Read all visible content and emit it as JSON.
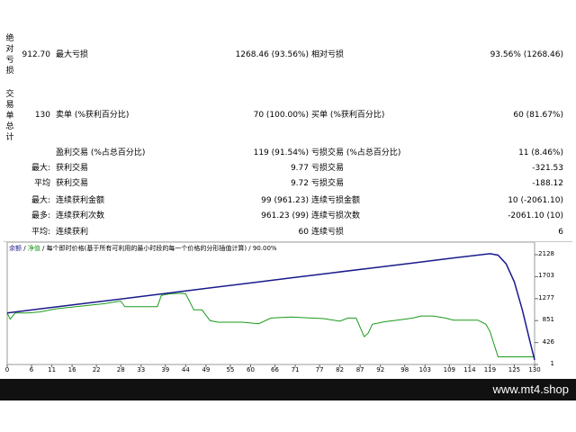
{
  "side_labels": {
    "drawdown": "绝对亏损",
    "trades": "交易单总计"
  },
  "rows": [
    {
      "c1": "912.70",
      "c2": "最大亏损",
      "c3": "1268.46 (93.56%)",
      "c4": "相对亏损",
      "c5": "93.56% (1268.46)"
    },
    {
      "c1": "130",
      "c2": "卖单 (%获利百分比)",
      "c3": "70 (100.00%)",
      "c4": "买单 (%获利百分比)",
      "c5": "60 (81.67%)"
    },
    {
      "c1": "",
      "c2": "盈利交易 (%占总百分比)",
      "c3": "119 (91.54%)",
      "c4": "亏损交易 (%占总百分比)",
      "c5": "11 (8.46%)"
    },
    {
      "c1": "最大:",
      "c2": "获利交易",
      "c3": "9.77",
      "c4": "亏损交易",
      "c5": "-321.53"
    },
    {
      "c1": "平均",
      "c2": "获利交易",
      "c3": "9.72",
      "c4": "亏损交易",
      "c5": "-188.12"
    },
    {
      "c1": "最大:",
      "c2": "连续获利金额",
      "c3": "99 (961.23)",
      "c4": "连续亏损金额",
      "c5": "10 (-2061.10)"
    },
    {
      "c1": "最多:",
      "c2": "连续获利次数",
      "c3": "961.23 (99)",
      "c4": "连续亏损次数",
      "c5": "-2061.10 (10)"
    },
    {
      "c1": "平均:",
      "c2": "连续获利",
      "c3": "60",
      "c4": "连续亏损",
      "c5": "6"
    }
  ],
  "legend": {
    "balance": "余额",
    "equity": "净值",
    "rest": " / 每个即时价格(基于所有可利用的最小时段的每一个价格的分形插值计算) / 90.00%"
  },
  "colors": {
    "balance": "#1a1a8c",
    "equity": "#1a9a1a"
  },
  "chart_data": {
    "type": "line",
    "x_ticks": [
      0,
      6,
      11,
      16,
      22,
      28,
      33,
      39,
      44,
      49,
      55,
      60,
      66,
      71,
      77,
      82,
      87,
      92,
      98,
      103,
      109,
      114,
      119,
      125,
      130
    ],
    "y_ticks": [
      2128,
      1703,
      1277,
      851,
      426,
      1
    ],
    "xlim": [
      0,
      130
    ],
    "ylim": [
      1,
      2128
    ],
    "series": [
      {
        "name": "余额",
        "x": [
          0,
          10,
          20,
          30,
          40,
          50,
          60,
          70,
          80,
          90,
          100,
          110,
          119,
          121,
          123,
          125,
          127,
          129,
          130
        ],
        "y": [
          1000,
          1097,
          1194,
          1290,
          1387,
          1484,
          1581,
          1678,
          1775,
          1871,
          1968,
          2065,
          2148,
          2120,
          1950,
          1600,
          1050,
          400,
          90
        ]
      },
      {
        "name": "净值",
        "x": [
          0,
          0.7,
          2,
          5,
          8,
          12,
          18,
          24,
          28,
          29,
          31,
          35,
          37,
          38,
          40,
          43,
          44,
          46,
          48,
          50,
          52,
          56,
          58,
          62,
          65,
          70,
          75,
          78,
          82,
          84,
          86,
          87,
          88,
          89,
          90,
          93,
          97,
          100,
          102,
          105,
          108,
          110,
          112,
          114,
          116,
          118,
          119,
          121,
          125,
          129,
          130
        ],
        "y": [
          1000,
          880,
          1000,
          1000,
          1020,
          1080,
          1130,
          1180,
          1230,
          1120,
          1120,
          1120,
          1120,
          1340,
          1370,
          1380,
          1370,
          1060,
          1060,
          850,
          820,
          820,
          820,
          790,
          900,
          920,
          900,
          890,
          840,
          900,
          900,
          720,
          540,
          610,
          780,
          830,
          870,
          900,
          940,
          940,
          900,
          860,
          860,
          860,
          860,
          780,
          640,
          150,
          150,
          150,
          150
        ]
      }
    ]
  },
  "footer_text": "www.mt4.shop"
}
